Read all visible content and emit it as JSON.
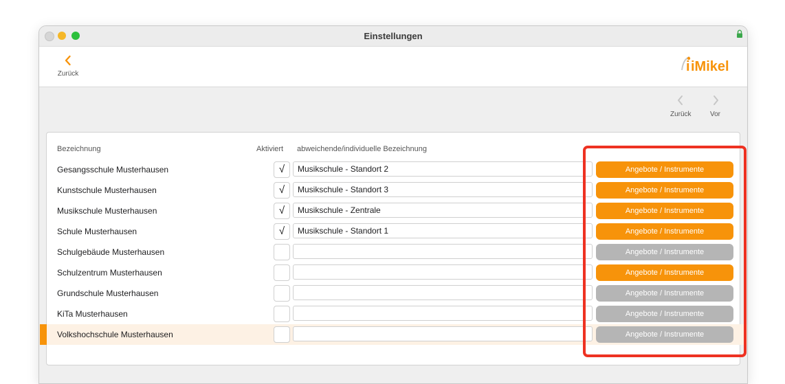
{
  "window": {
    "title": "Einstellungen"
  },
  "toolbar": {
    "back_label": "Zurück",
    "logo_text": "iMikel"
  },
  "nav": {
    "prev_label": "Zurück",
    "next_label": "Vor"
  },
  "table": {
    "headers": {
      "name": "Bezeichnung",
      "active": "Aktiviert",
      "alt": "abweichende/individuelle Bezeichnung"
    },
    "rows": [
      {
        "name": "Gesangsschule Musterhausen",
        "checked": "√",
        "alt": "Musikschule - Standort 2",
        "button": "Angebote / Instrumente",
        "button_state": "active"
      },
      {
        "name": "Kunstschule Musterhausen",
        "checked": "√",
        "alt": "Musikschule - Standort 3",
        "button": "Angebote / Instrumente",
        "button_state": "active"
      },
      {
        "name": "Musikschule Musterhausen",
        "checked": "√",
        "alt": "Musikschule - Zentrale",
        "button": "Angebote / Instrumente",
        "button_state": "active"
      },
      {
        "name": "Schule Musterhausen",
        "checked": "√",
        "alt": "Musikschule - Standort 1",
        "button": "Angebote / Instrumente",
        "button_state": "active"
      },
      {
        "name": "Schulgebäude Musterhausen",
        "checked": "",
        "alt": "",
        "button": "Angebote / Instrumente",
        "button_state": "inactive"
      },
      {
        "name": "Schulzentrum Musterhausen",
        "checked": "",
        "alt": "",
        "button": "Angebote / Instrumente",
        "button_state": "active"
      },
      {
        "name": "Grundschule Musterhausen",
        "checked": "",
        "alt": "",
        "button": "Angebote / Instrumente",
        "button_state": "inactive"
      },
      {
        "name": "KiTa Musterhausen",
        "checked": "",
        "alt": "",
        "button": "Angebote / Instrumente",
        "button_state": "inactive"
      },
      {
        "name": "Volkshochschule Musterhausen",
        "checked": "",
        "alt": "",
        "button": "Angebote / Instrumente",
        "button_state": "inactive",
        "selected": true
      }
    ]
  },
  "colors": {
    "accent": "#f7930a",
    "disabled": "#b5b5b5",
    "highlight": "#ee3222",
    "selected_row": "#fdf1e4"
  }
}
